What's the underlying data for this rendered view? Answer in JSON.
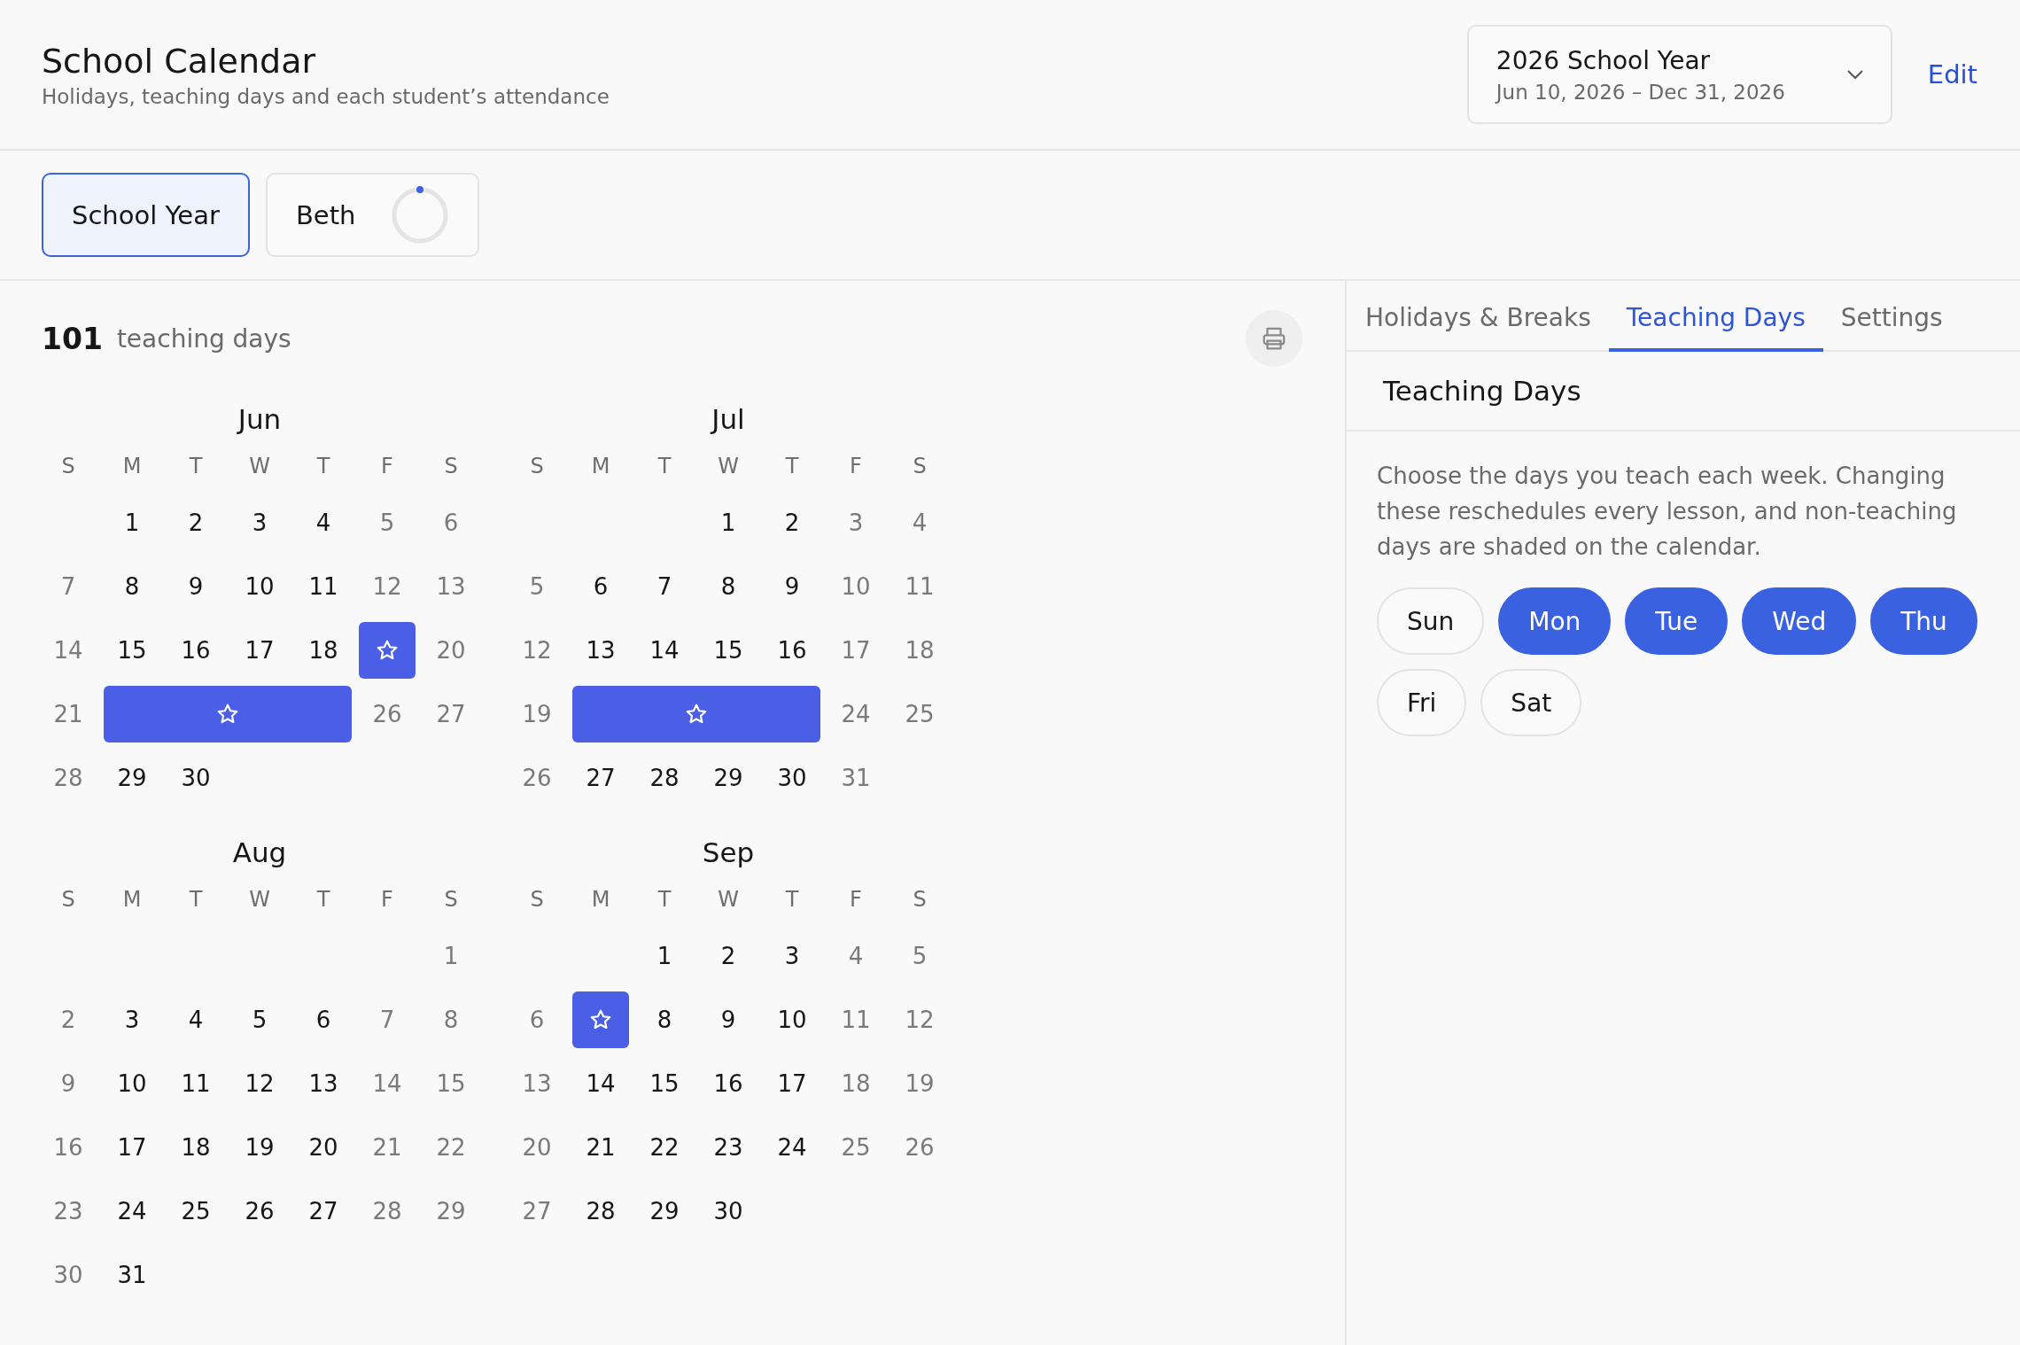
{
  "header": {
    "title": "School Calendar",
    "subtitle": "Holidays, teaching days and each student’s attendance",
    "year_select": {
      "title": "2026 School Year",
      "range": "Jun 10, 2026 – Dec 31, 2026"
    },
    "edit": "Edit"
  },
  "views": [
    {
      "label": "School Year",
      "selected": true,
      "kind": "plain"
    },
    {
      "label": "Beth",
      "selected": false,
      "kind": "progress"
    }
  ],
  "summary": {
    "count": "101",
    "label": "teaching days"
  },
  "months": [
    {
      "name": "Jun",
      "weekdays": [
        "S",
        "M",
        "T",
        "W",
        "T",
        "F",
        "S"
      ],
      "weeks": [
        [
          {
            "kind": "blank"
          },
          "1",
          "2",
          "3",
          "4",
          "5",
          "6"
        ],
        [
          "7",
          "8",
          "9",
          "10",
          "11",
          "12",
          "13"
        ],
        [
          "14",
          "15",
          "16",
          "17",
          "18",
          {
            "kind": "holiday"
          },
          "20"
        ],
        [
          "21",
          {
            "kind": "holiday"
          },
          {
            "kind": "holiday"
          },
          {
            "kind": "holiday"
          },
          {
            "kind": "holiday"
          },
          "26",
          "27"
        ],
        [
          "28",
          "29",
          "30"
        ]
      ]
    },
    {
      "name": "Jul",
      "weekdays": [
        "S",
        "M",
        "T",
        "W",
        "T",
        "F",
        "S"
      ],
      "weeks": [
        [
          {
            "kind": "blank"
          },
          {
            "kind": "blank"
          },
          {
            "kind": "blank"
          },
          "1",
          "2",
          "3",
          "4"
        ],
        [
          "5",
          "6",
          "7",
          "8",
          "9",
          "10",
          "11"
        ],
        [
          "12",
          "13",
          "14",
          "15",
          "16",
          "17",
          "18"
        ],
        [
          "19",
          {
            "kind": "holiday"
          },
          {
            "kind": "holiday"
          },
          {
            "kind": "holiday"
          },
          {
            "kind": "holiday"
          },
          "24",
          "25"
        ],
        [
          "26",
          "27",
          "28",
          "29",
          "30",
          "31"
        ]
      ]
    },
    {
      "name": "Aug",
      "weekdays": [
        "S",
        "M",
        "T",
        "W",
        "T",
        "F",
        "S"
      ],
      "weeks": [
        [
          {
            "kind": "blank"
          },
          {
            "kind": "blank"
          },
          {
            "kind": "blank"
          },
          {
            "kind": "blank"
          },
          {
            "kind": "blank"
          },
          {
            "kind": "blank"
          },
          "1"
        ],
        [
          "2",
          "3",
          "4",
          "5",
          "6",
          "7",
          "8"
        ],
        [
          "9",
          "10",
          "11",
          "12",
          "13",
          "14",
          "15"
        ],
        [
          "16",
          "17",
          "18",
          "19",
          "20",
          "21",
          "22"
        ],
        [
          "23",
          "24",
          "25",
          "26",
          "27",
          "28",
          "29"
        ],
        [
          "30",
          "31"
        ]
      ]
    },
    {
      "name": "Sep",
      "weekdays": [
        "S",
        "M",
        "T",
        "W",
        "T",
        "F",
        "S"
      ],
      "weeks": [
        [
          {
            "kind": "blank"
          },
          {
            "kind": "blank"
          },
          "1",
          "2",
          "3",
          "4",
          "5"
        ],
        [
          "6",
          {
            "kind": "holiday"
          },
          "8",
          "9",
          "10",
          "11",
          "12"
        ],
        [
          "13",
          "14",
          "15",
          "16",
          "17",
          "18",
          "19"
        ],
        [
          "20",
          "21",
          "22",
          "23",
          "24",
          "25",
          "26"
        ],
        [
          "27",
          "28",
          "29",
          "30"
        ]
      ]
    }
  ],
  "panel": {
    "tabs": [
      {
        "label": "Holidays & Breaks",
        "selected": false
      },
      {
        "label": "Teaching Days",
        "selected": true
      },
      {
        "label": "Settings",
        "selected": false
      }
    ],
    "heading": "Teaching Days",
    "description": "Choose the days you teach each week. Changing these reschedules every lesson, and non-teaching days are shaded on the calendar.",
    "days": [
      {
        "label": "Sun",
        "selected": false
      },
      {
        "label": "Mon",
        "selected": true
      },
      {
        "label": "Tue",
        "selected": true
      },
      {
        "label": "Wed",
        "selected": true
      },
      {
        "label": "Thu",
        "selected": true
      },
      {
        "label": "Fri",
        "selected": false
      },
      {
        "label": "Sat",
        "selected": false
      }
    ]
  }
}
